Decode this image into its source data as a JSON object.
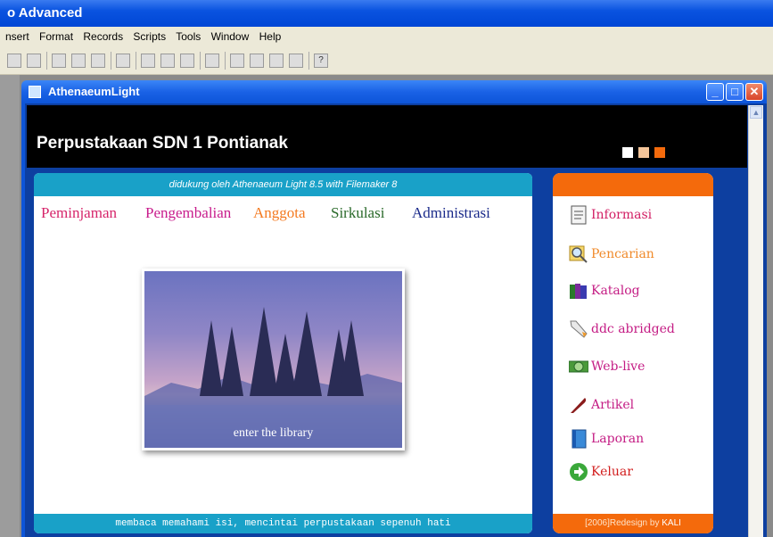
{
  "app": {
    "title": "o Advanced"
  },
  "menu": [
    "nsert",
    "Format",
    "Records",
    "Scripts",
    "Tools",
    "Window",
    "Help"
  ],
  "toolbar_icons": [
    "print-preview-icon",
    "spelling-icon",
    "cut-icon",
    "copy-icon",
    "paste-icon",
    "undo-icon",
    "new-record-icon",
    "duplicate-record-icon",
    "delete-record-icon",
    "sort-icon",
    "find-icon",
    "script-icon",
    "send-mail-icon",
    "sort-ascending-icon",
    "help-icon"
  ],
  "window": {
    "title": "AthenaeumLight",
    "min": "_",
    "max": "□",
    "close": "✕"
  },
  "header": {
    "title": "Perpustakaan SDN 1 Pontianak",
    "squares": [
      "#ffffff",
      "#f5c59a",
      "#f46a0c"
    ]
  },
  "main": {
    "tagline": "didukung oleh Athenaeum Light 8.5 with Filemaker 8",
    "nav": [
      {
        "label": "Peminjaman",
        "color": "#d6246a"
      },
      {
        "label": "Pengembalian",
        "color": "#c81c8c"
      },
      {
        "label": "Anggota",
        "color": "#f47a20"
      },
      {
        "label": "Sirkulasi",
        "color": "#2a6a2a"
      },
      {
        "label": "Administrasi",
        "color": "#1a2a8a"
      }
    ],
    "hero_caption": "enter the library",
    "footer": "membaca memahami isi, mencintai perpustakaan sepenuh hati"
  },
  "sidebar": {
    "items": [
      {
        "label": "Informasi",
        "icon": "document-icon",
        "color": "#d21e64"
      },
      {
        "label": "Pencarian",
        "icon": "magnifier-icon",
        "color": "#f08a2a"
      },
      {
        "label": "Katalog",
        "icon": "books-icon",
        "color": "#c41c84"
      },
      {
        "label": "ddc abridged",
        "icon": "pencil-icon",
        "color": "#c41c84"
      },
      {
        "label": "Web-live",
        "icon": "globe-icon",
        "color": "#c41c84"
      },
      {
        "label": "Artikel",
        "icon": "quill-icon",
        "color": "#c41c84"
      },
      {
        "label": "Laporan",
        "icon": "binder-icon",
        "color": "#c41c84"
      },
      {
        "label": "Keluar",
        "icon": "exit-arrow-icon",
        "color": "#d21e1e"
      }
    ],
    "footer_prefix": "[2006]Redesign by",
    "footer_name": "KALI"
  }
}
